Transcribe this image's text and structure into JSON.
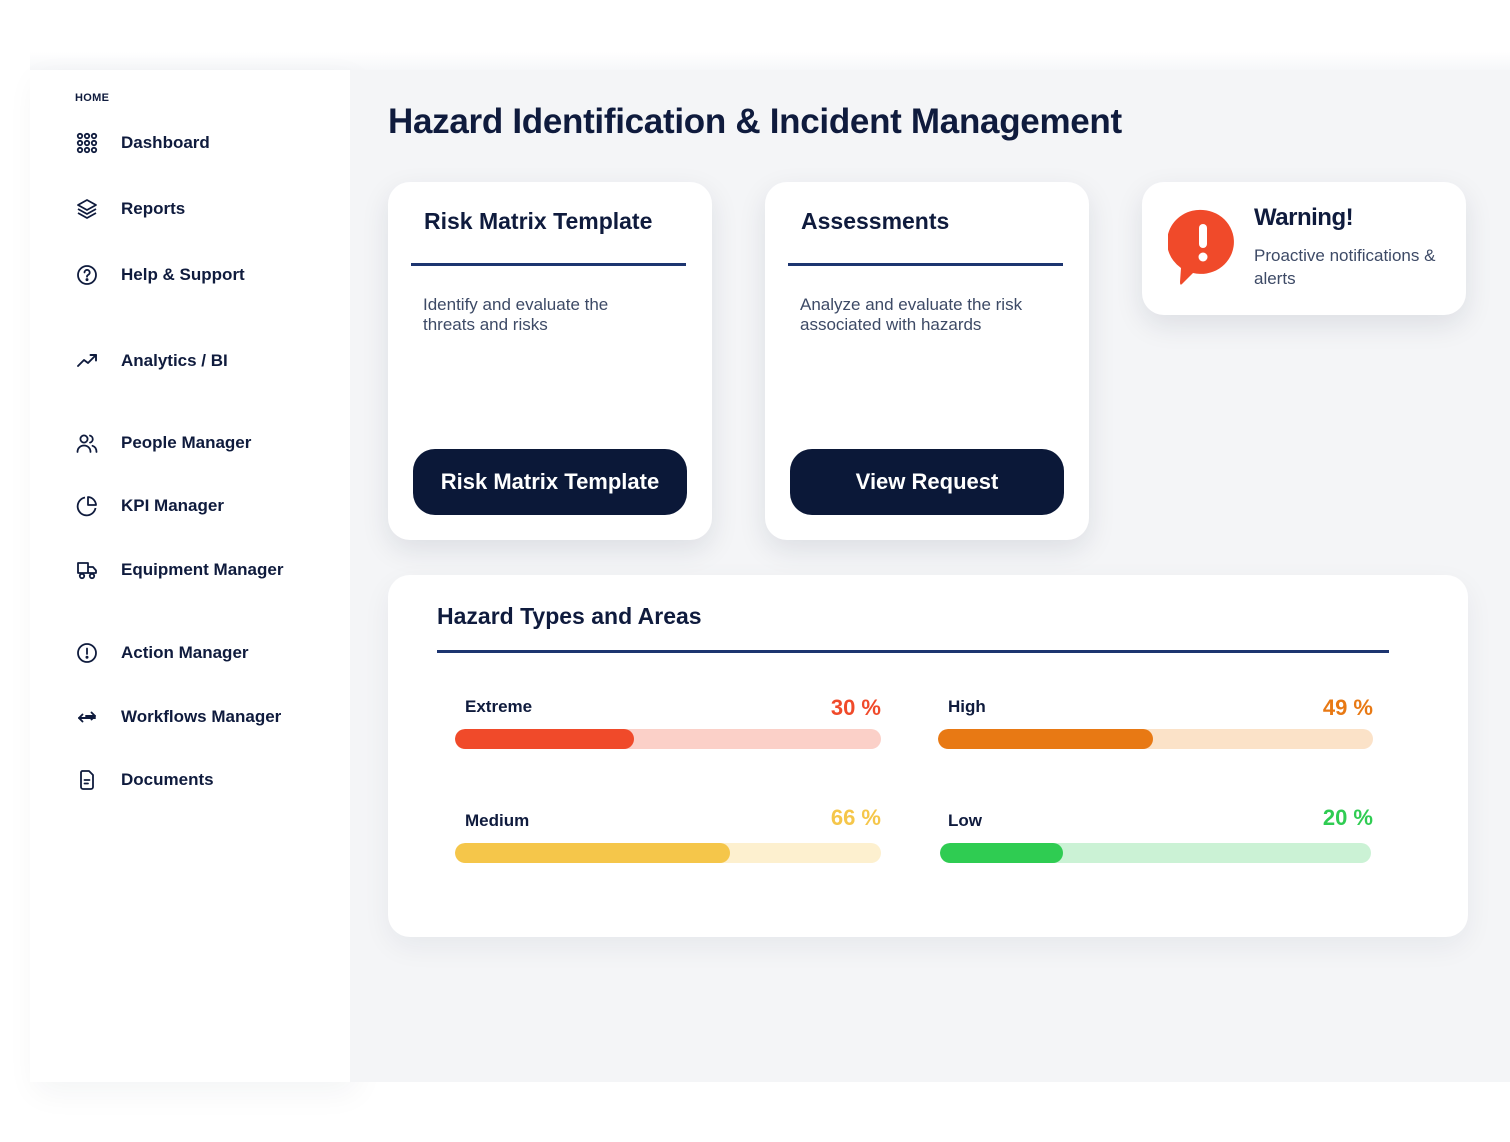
{
  "sidebar": {
    "section_label": "HOME",
    "items": [
      {
        "label": "Dashboard",
        "icon": "grid-icon"
      },
      {
        "label": "Reports",
        "icon": "layers-icon"
      },
      {
        "label": "Help & Support",
        "icon": "help-circle-icon"
      },
      {
        "label": "Analytics / BI",
        "icon": "trending-up-icon"
      },
      {
        "label": "People Manager",
        "icon": "users-icon"
      },
      {
        "label": "KPI Manager",
        "icon": "pie-chart-icon"
      },
      {
        "label": "Equipment Manager",
        "icon": "truck-icon"
      },
      {
        "label": "Action Manager",
        "icon": "alert-circle-icon"
      },
      {
        "label": "Workflows Manager",
        "icon": "arrows-swap-icon"
      },
      {
        "label": "Documents",
        "icon": "document-icon"
      }
    ]
  },
  "main": {
    "title": "Hazard Identification & Incident Management",
    "cards": [
      {
        "title": "Risk Matrix Template",
        "description": "Identify and evaluate the threats and risks",
        "button": "Risk Matrix Template"
      },
      {
        "title": "Assessments",
        "description": "Analyze and evaluate the risk associated with  hazards",
        "button": "View Request"
      }
    ],
    "warning": {
      "title": "Warning!",
      "text": "Proactive notifications & alerts",
      "color": "#f04a2a"
    },
    "hazards": {
      "title": "Hazard Types and Areas",
      "levels": [
        {
          "name": "Extreme",
          "value_label": "30 %",
          "fraction": 0.42,
          "color": "#f04a2a",
          "track": "#fbd0c8"
        },
        {
          "name": "High",
          "value_label": "49 %",
          "fraction": 0.495,
          "color": "#e87914",
          "track": "#fbe2c8"
        },
        {
          "name": "Medium",
          "value_label": "66 %",
          "fraction": 0.645,
          "color": "#f5c64a",
          "track": "#fdf0cf"
        },
        {
          "name": "Low",
          "value_label": "20 %",
          "fraction": 0.285,
          "color": "#2fcc52",
          "track": "#cbf2d5"
        }
      ]
    }
  }
}
